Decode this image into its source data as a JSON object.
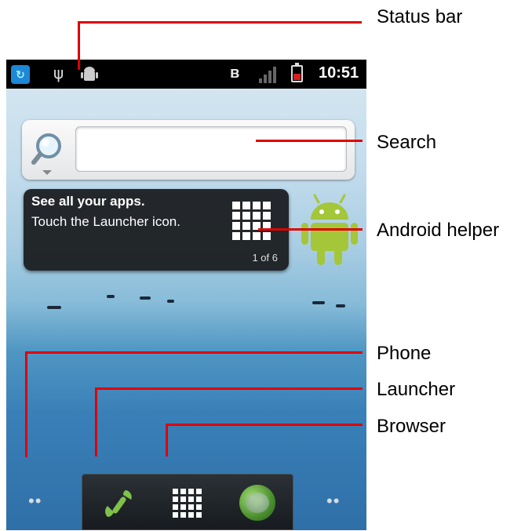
{
  "status_bar": {
    "time": "10:51"
  },
  "search": {
    "placeholder": ""
  },
  "helper": {
    "title": "See all your apps.",
    "body": "Touch the Launcher icon.",
    "page": "1 of 6"
  },
  "callouts": {
    "status_bar": "Status bar",
    "search": "Search",
    "android_helper": "Android helper",
    "phone": "Phone",
    "launcher": "Launcher",
    "browser": "Browser"
  },
  "dock": {
    "left_dots": "••",
    "right_dots": "••"
  },
  "colors": {
    "callout": "#e00000",
    "android_green": "#a4c639"
  }
}
